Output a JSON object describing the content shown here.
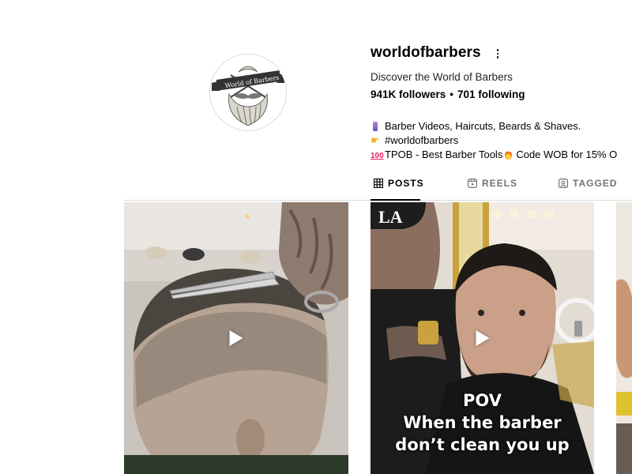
{
  "profile": {
    "username": "worldofbarbers",
    "full_name": "Discover the World of Barbers",
    "followers": "941K followers",
    "separator": "•",
    "following": "701 following",
    "avatar_text": "World of Barbers",
    "bio": [
      {
        "icon": "barber-pole-emoji",
        "text": "Barber Videos, Haircuts, Beards & Shaves."
      },
      {
        "icon": "pointing-hand-emoji",
        "text": "#worldofbarbers"
      },
      {
        "icon": "hundred-points-emoji",
        "text_before": "TPOB - Best Barber Tools",
        "text_after": "Code WOB for 15% O"
      }
    ]
  },
  "tabs": [
    {
      "label": "POSTS",
      "icon": "grid-icon",
      "active": true
    },
    {
      "label": "REELS",
      "icon": "reels-icon",
      "active": false
    },
    {
      "label": "TAGGED",
      "icon": "tagged-icon",
      "active": false
    }
  ],
  "posts": [
    {
      "type": "video",
      "caption_lines": []
    },
    {
      "type": "video",
      "caption_lines": [
        "POV",
        "When the barber",
        "don’t clean you up"
      ]
    },
    {
      "type": "video",
      "caption_lines": []
    }
  ],
  "colors": {
    "muted_text": "#737373",
    "divider": "#dbdbdb"
  }
}
